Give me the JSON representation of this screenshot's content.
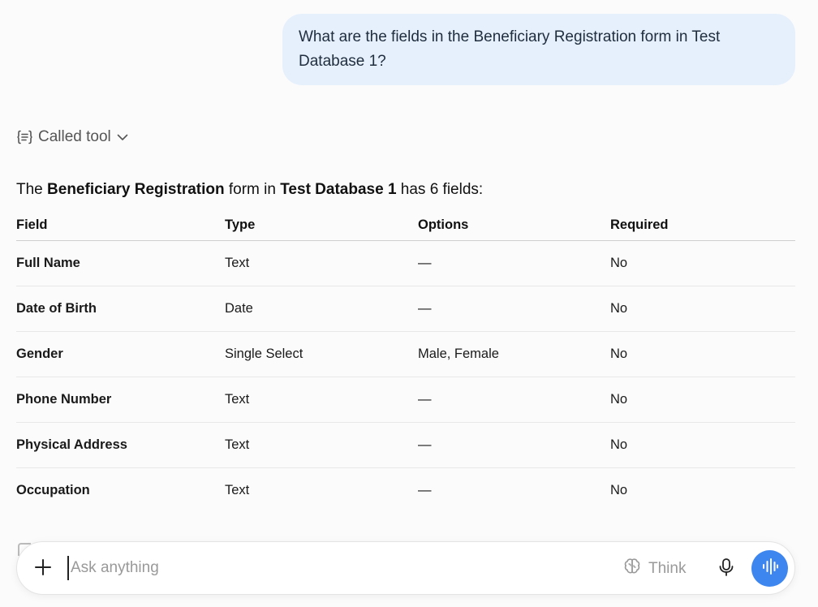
{
  "user_message": "What are the fields in the Beneficiary Registration form in Test Database 1?",
  "tool_call": {
    "label": "Called tool",
    "icon": "braces-list-icon",
    "toggle_icon": "chevron-down-icon"
  },
  "answer": {
    "prefix": "The ",
    "form_name": "Beneficiary Registration",
    "middle": " form in ",
    "database_name": "Test Database 1",
    "suffix": " has 6 fields:"
  },
  "table": {
    "headers": [
      "Field",
      "Type",
      "Options",
      "Required"
    ],
    "rows": [
      {
        "field": "Full Name",
        "type": "Text",
        "options": "—",
        "required": "No"
      },
      {
        "field": "Date of Birth",
        "type": "Date",
        "options": "—",
        "required": "No"
      },
      {
        "field": "Gender",
        "type": "Single Select",
        "options": "Male, Female",
        "required": "No"
      },
      {
        "field": "Phone Number",
        "type": "Text",
        "options": "—",
        "required": "No"
      },
      {
        "field": "Physical Address",
        "type": "Text",
        "options": "—",
        "required": "No"
      },
      {
        "field": "Occupation",
        "type": "Text",
        "options": "—",
        "required": "No"
      }
    ]
  },
  "composer": {
    "placeholder": "Ask anything",
    "value": "",
    "think_label": "Think",
    "icons": {
      "attach": "plus-icon",
      "think": "brain-icon",
      "mic": "microphone-icon",
      "voice": "voice-waveform-icon"
    }
  },
  "colors": {
    "user_bubble": "#e6f0fc",
    "voice_button": "#3d86f0",
    "background": "#fbfbfb"
  }
}
